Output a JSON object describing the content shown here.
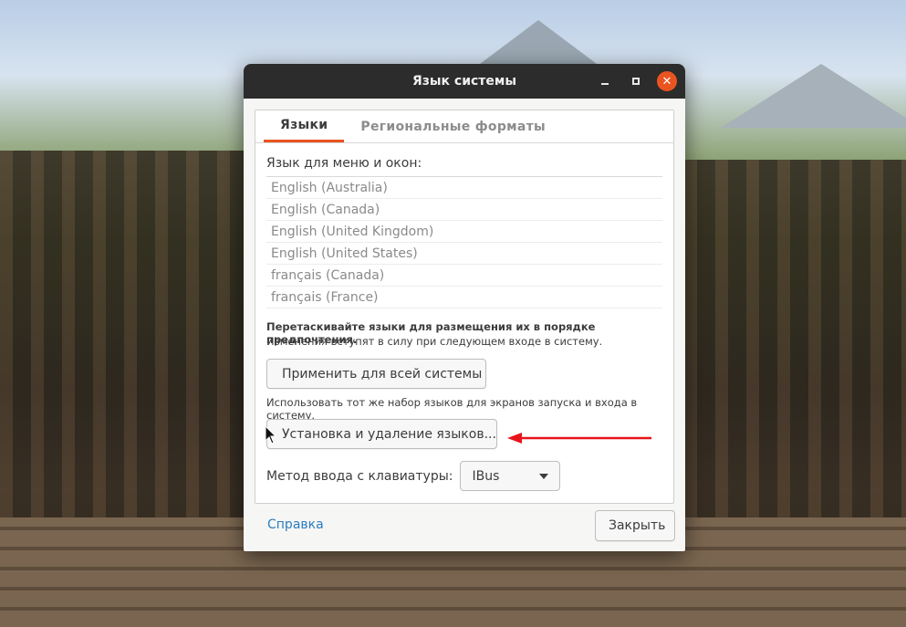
{
  "window": {
    "title": "Язык системы",
    "controls": {
      "minimize_icon": "minimize-icon",
      "maximize_icon": "maximize-icon",
      "close_icon": "close-icon"
    }
  },
  "tabs": [
    {
      "label": "Языки",
      "active": true
    },
    {
      "label": "Региональные форматы",
      "active": false
    }
  ],
  "languages": {
    "label": "Язык для меню и окон:",
    "items": [
      "English (Australia)",
      "English (Canada)",
      "English (United Kingdom)",
      "English (United States)",
      "français (Canada)",
      "français (France)"
    ]
  },
  "hints": {
    "drag": "Перетаскивайте языки для размещения их в порядке предпочтения.",
    "apply_effect": "Изменения вступят в силу при следующем входе в систему.",
    "same_set": "Использовать тот же набор языков для экранов запуска и входа в систему."
  },
  "buttons": {
    "apply_system": "Применить для всей системы",
    "install_remove": "Установка и удаление языков...",
    "close": "Закрыть"
  },
  "input_method": {
    "label": "Метод ввода с клавиатуры:",
    "selected": "IBus"
  },
  "help_link": "Справка",
  "colors": {
    "accent": "#e95420",
    "titlebar": "#2c2c2c",
    "link": "#2a7dbf",
    "annotation_arrow": "#e8141b"
  }
}
